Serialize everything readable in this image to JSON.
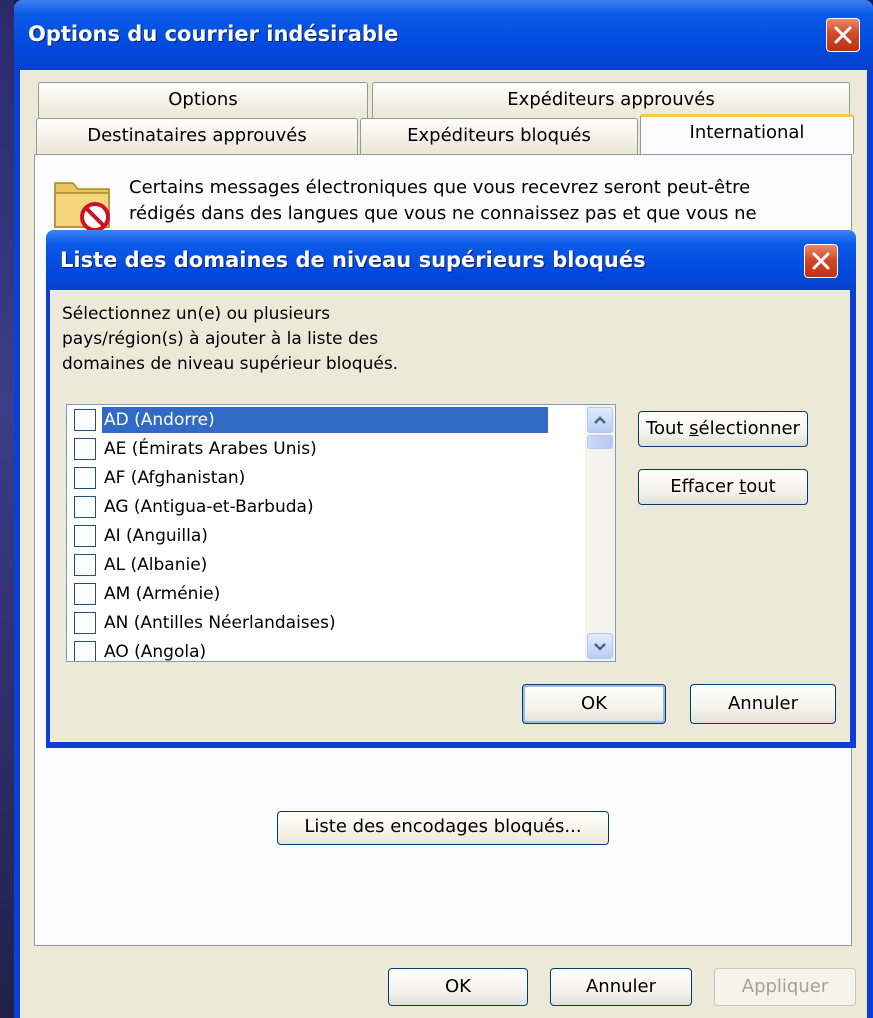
{
  "outer_window": {
    "title": "Options du courrier indésirable",
    "tabs_back_row": [
      "Options",
      "Expéditeurs approuvés"
    ],
    "tabs_front_row": [
      "Destinataires approuvés",
      "Expéditeurs bloqués",
      "International"
    ],
    "active_tab": "International",
    "intro_line_1": "Certains messages électroniques que vous recevrez seront peut-être",
    "intro_line_2": "rédigés dans des langues que vous ne connaissez pas et que vous ne",
    "partial_button_label": "Liste des encodages bloqués...",
    "buttons": {
      "ok": "OK",
      "cancel": "Annuler",
      "apply": "Appliquer"
    }
  },
  "dialog": {
    "title": "Liste des domaines de niveau supérieurs bloqués",
    "instruction_line_1": "Sélectionnez un(e) ou plusieurs",
    "instruction_line_2": "pays/région(s) à ajouter à la liste des",
    "instruction_line_3": "domaines de niveau supérieur bloqués.",
    "items": [
      {
        "label": "AD (Andorre)",
        "checked": false,
        "selected": true
      },
      {
        "label": "AE (Émirats Arabes Unis)",
        "checked": false,
        "selected": false
      },
      {
        "label": "AF (Afghanistan)",
        "checked": false,
        "selected": false
      },
      {
        "label": "AG (Antigua-et-Barbuda)",
        "checked": false,
        "selected": false
      },
      {
        "label": "AI (Anguilla)",
        "checked": false,
        "selected": false
      },
      {
        "label": "AL (Albanie)",
        "checked": false,
        "selected": false
      },
      {
        "label": "AM (Arménie)",
        "checked": false,
        "selected": false
      },
      {
        "label": "AN (Antilles Néerlandaises)",
        "checked": false,
        "selected": false
      },
      {
        "label": "AO (Angola)",
        "checked": false,
        "selected": false
      }
    ],
    "buttons": {
      "select_all_pre": "Tout ",
      "select_all_key": "s",
      "select_all_post": "électionner",
      "clear_all_pre": "Effacer ",
      "clear_all_key": "t",
      "clear_all_post": "out",
      "ok": "OK",
      "cancel": "Annuler"
    }
  },
  "icons": {
    "close": "close-icon",
    "junk_mail": "folder-blocked-icon",
    "scroll_up": "arrow-up-icon",
    "scroll_down": "arrow-down-icon"
  },
  "colors": {
    "title_bar_blue": "#0a5ae8",
    "close_red": "#d24a2a",
    "dialog_face": "#ece9d8",
    "selection_blue": "#316ac5",
    "active_tab_accent": "#ffc83c"
  }
}
